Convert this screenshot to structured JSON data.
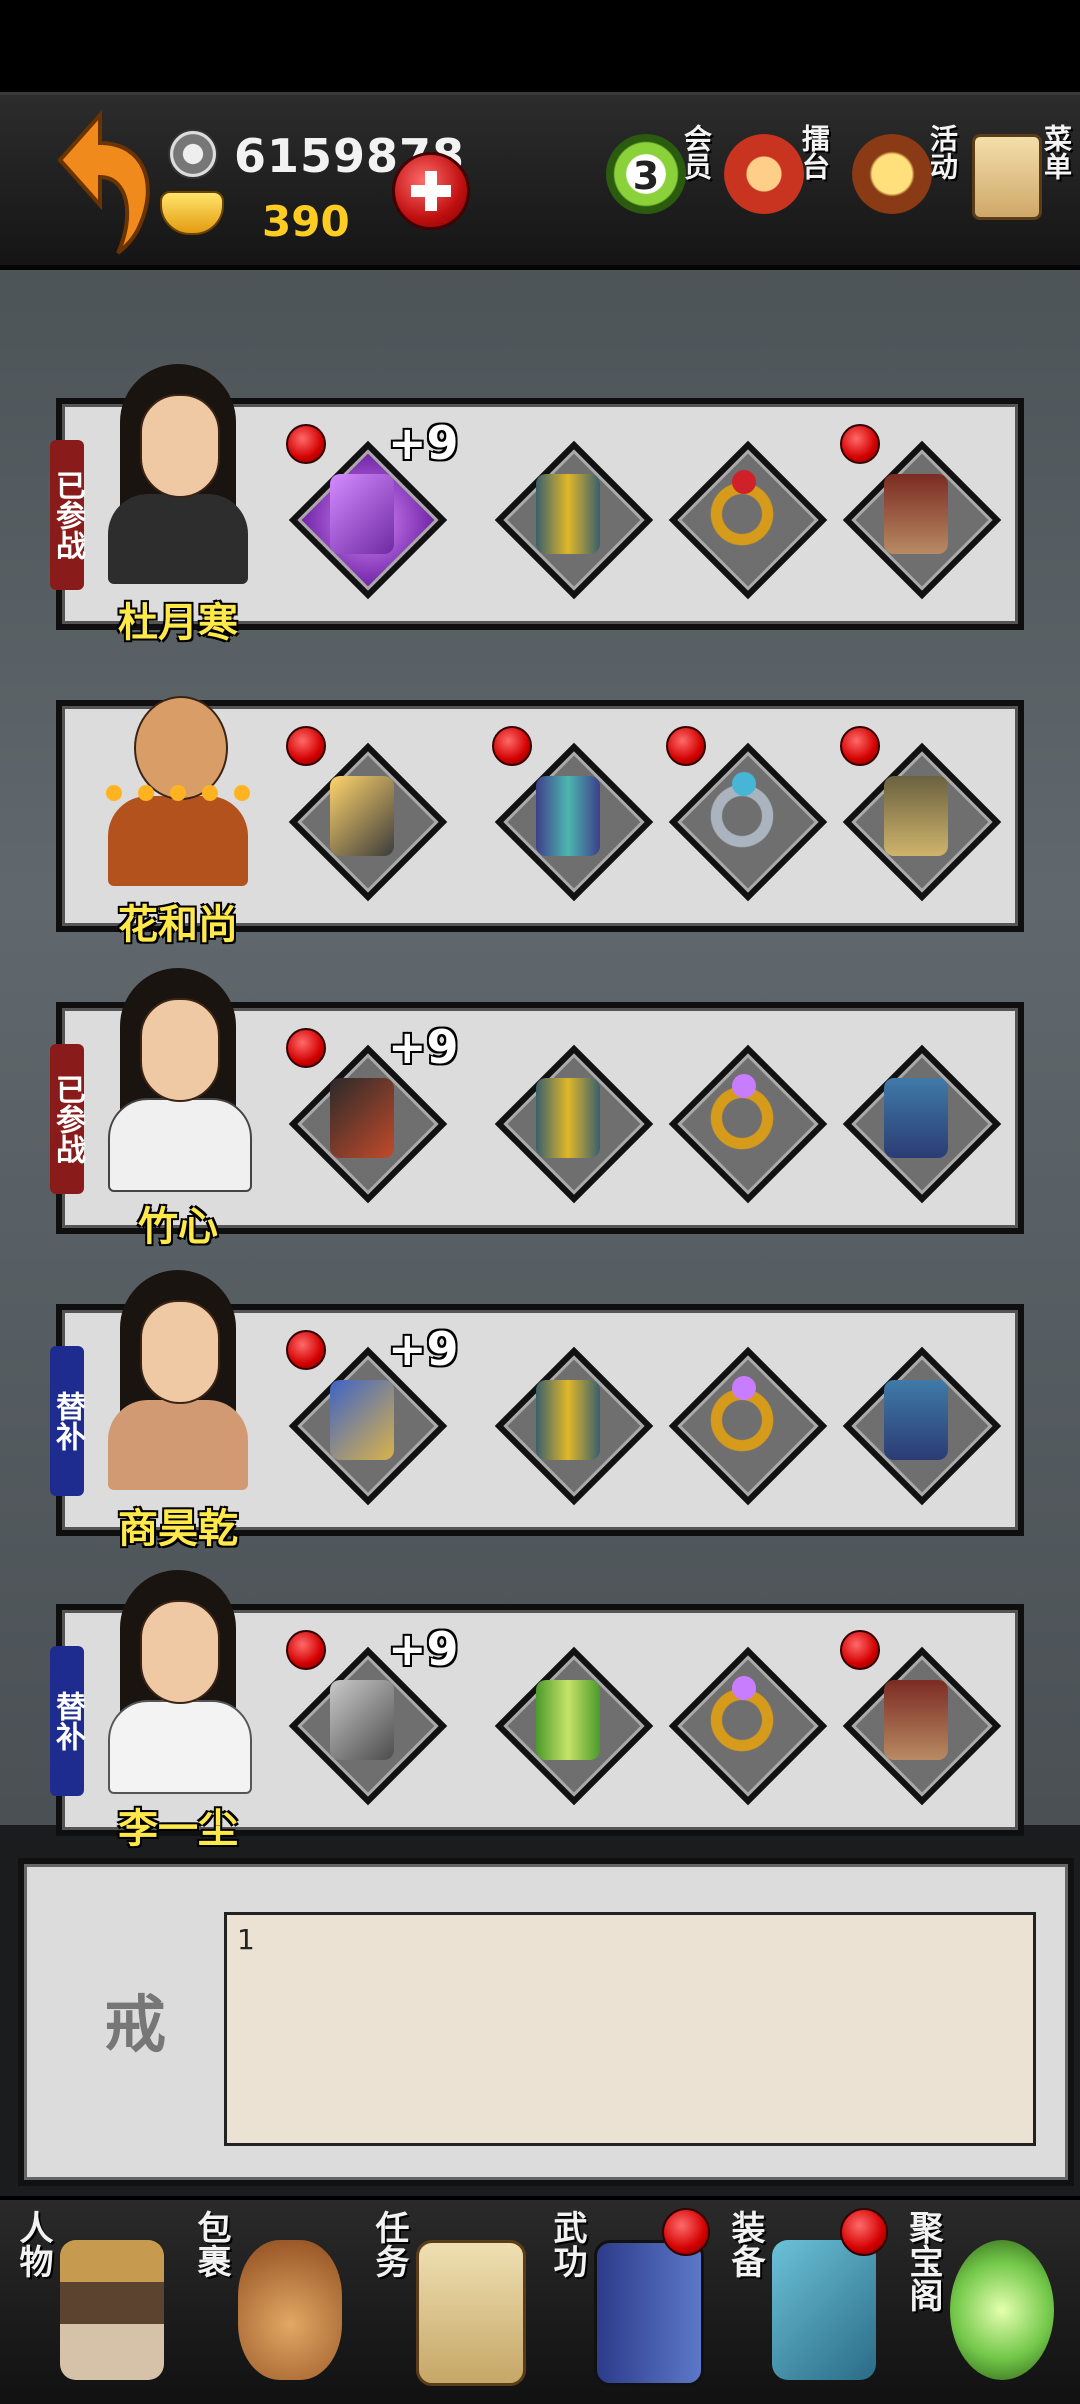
{
  "currency": {
    "coins": "6159878",
    "gold": "390"
  },
  "top_menu": [
    {
      "label": "会员",
      "icon": "vip-badge-icon",
      "badge": "3"
    },
    {
      "label": "擂台",
      "icon": "arena-drum-icon"
    },
    {
      "label": "活动",
      "icon": "activity-fan-icon"
    },
    {
      "label": "菜单",
      "icon": "menu-scroll-icon"
    }
  ],
  "heroes": [
    {
      "name": "杜月寒",
      "status": "已参战",
      "status_type": "battle",
      "weapon": {
        "plus": "+9",
        "dot": true,
        "style": "purple",
        "glow": true
      },
      "armor": {
        "dot": false,
        "style": ""
      },
      "ring": {
        "dot": false,
        "style": "red"
      },
      "boot": {
        "dot": true,
        "style": ""
      }
    },
    {
      "name": "花和尚",
      "status": "",
      "status_type": "none",
      "weapon": {
        "plus": "",
        "dot": true,
        "style": "gold",
        "glow": false
      },
      "armor": {
        "dot": true,
        "style": "blue"
      },
      "ring": {
        "dot": true,
        "style": "silver"
      },
      "boot": {
        "dot": true,
        "style": "tan"
      }
    },
    {
      "name": "竹心",
      "status": "已参战",
      "status_type": "battle",
      "weapon": {
        "plus": "+9",
        "dot": true,
        "style": "black",
        "glow": false
      },
      "armor": {
        "dot": false,
        "style": ""
      },
      "ring": {
        "dot": false,
        "style": "purple"
      },
      "boot": {
        "dot": false,
        "style": "blue"
      }
    },
    {
      "name": "商昊乾",
      "status": "替补",
      "status_type": "sub",
      "weapon": {
        "plus": "+9",
        "dot": true,
        "style": "blue",
        "glow": false
      },
      "armor": {
        "dot": false,
        "style": ""
      },
      "ring": {
        "dot": false,
        "style": "purple"
      },
      "boot": {
        "dot": false,
        "style": "blue"
      }
    },
    {
      "name": "李一尘",
      "status": "替补",
      "status_type": "sub",
      "weapon": {
        "plus": "+9",
        "dot": true,
        "style": "",
        "glow": false
      },
      "armor": {
        "dot": false,
        "style": "green"
      },
      "ring": {
        "dot": false,
        "style": "purple"
      },
      "boot": {
        "dot": true,
        "style": ""
      }
    }
  ],
  "description": {
    "label": "戒",
    "text": "1"
  },
  "bottom_nav": [
    {
      "label": "人物",
      "icon": "character-hat-icon",
      "dot": false
    },
    {
      "label": "包裹",
      "icon": "bag-icon",
      "dot": false
    },
    {
      "label": "任务",
      "icon": "quest-scroll-icon",
      "dot": false
    },
    {
      "label": "武功",
      "icon": "martial-book-icon",
      "dot": true
    },
    {
      "label": "装备",
      "icon": "equipment-blade-icon",
      "dot": true
    },
    {
      "label": "聚宝阁",
      "icon": "treasure-orb-icon",
      "dot": false
    }
  ]
}
